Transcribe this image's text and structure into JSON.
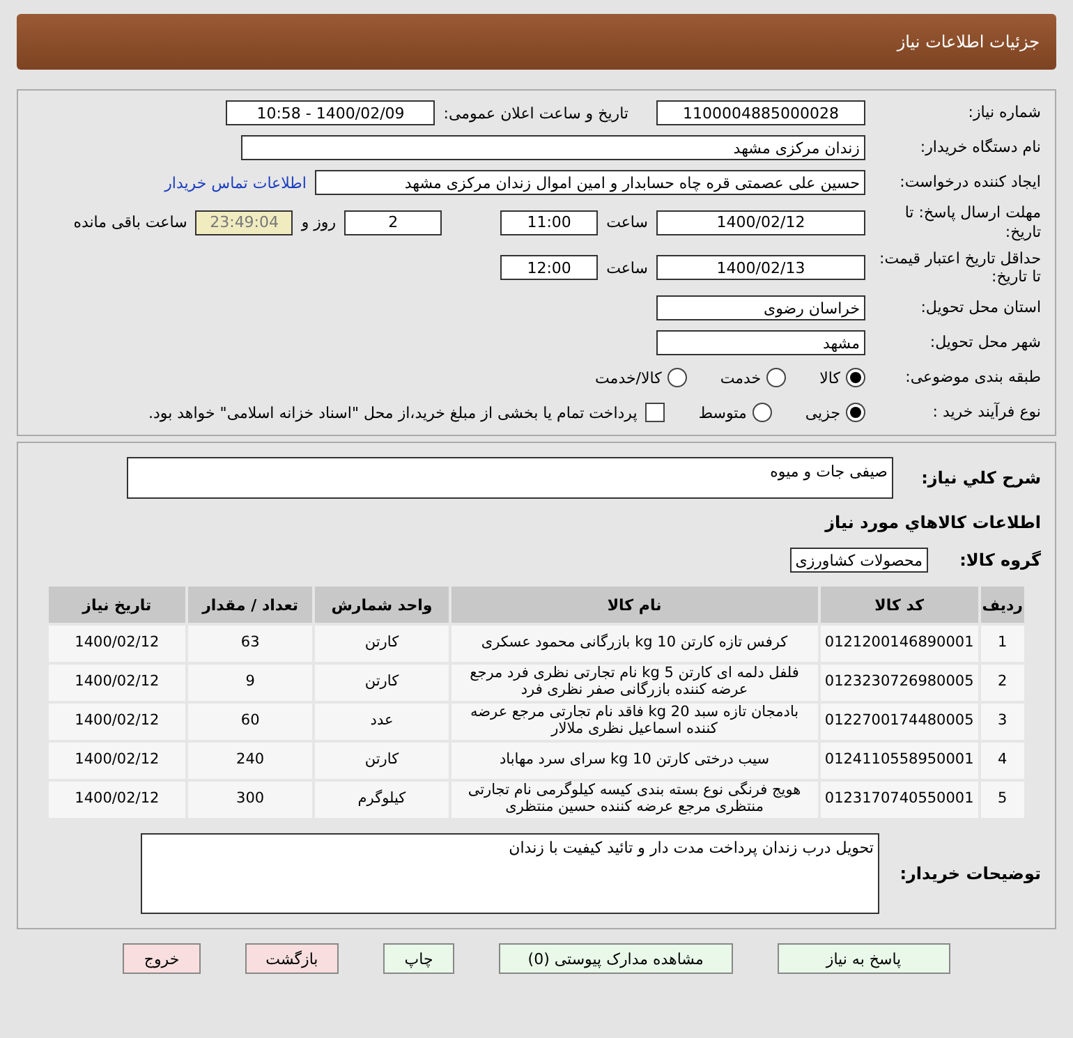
{
  "header": {
    "title": "جزئیات اطلاعات نیاز"
  },
  "need_number": {
    "label": "شماره نیاز:",
    "value": "1100004885000028"
  },
  "announce": {
    "label": "تاریخ و ساعت اعلان عمومی:",
    "value": "1400/02/09 - 10:58"
  },
  "buyer": {
    "label": "نام دستگاه خریدار:",
    "value": "زندان مرکزی مشهد"
  },
  "creator": {
    "label": "ایجاد کننده درخواست:",
    "value": "حسین علی عصمتی قره چاه حسابدار و امین اموال زندان مرکزی مشهد",
    "link": "اطلاعات تماس خریدار"
  },
  "deadline": {
    "label": "مهلت ارسال پاسخ: تا تاریخ:",
    "date": "1400/02/12",
    "time_label": "ساعت",
    "time": "11:00",
    "days": "2",
    "days_label": "روز و",
    "remaining": "23:49:04",
    "remaining_label": "ساعت باقی مانده"
  },
  "validity": {
    "label": "حداقل تاریخ اعتبار قیمت: تا تاریخ:",
    "date": "1400/02/13",
    "time_label": "ساعت",
    "time": "12:00"
  },
  "province": {
    "label": "استان محل تحویل:",
    "value": "خراسان رضوی"
  },
  "city": {
    "label": "شهر محل تحویل:",
    "value": "مشهد"
  },
  "category": {
    "label": "طبقه بندی موضوعی:",
    "options": [
      {
        "label": "کالا",
        "selected": true
      },
      {
        "label": "خدمت",
        "selected": false
      },
      {
        "label": "کالا/خدمت",
        "selected": false
      }
    ]
  },
  "process": {
    "label": "نوع فرآیند خرید :",
    "options": [
      {
        "label": "جزیی",
        "selected": true
      },
      {
        "label": "متوسط",
        "selected": false
      }
    ],
    "treasury": {
      "label": "پرداخت تمام یا بخشی از مبلغ خرید،از محل \"اسناد خزانه اسلامی\" خواهد بود.",
      "checked": false
    }
  },
  "description": {
    "label": "شرح کلي نياز:",
    "value": "صیفی جات و میوه"
  },
  "goods_heading": "اطلاعات کالاهاي مورد نياز",
  "goods_group": {
    "label": "گروه کالا:",
    "value": "محصولات کشاورزی"
  },
  "table": {
    "columns": [
      "ردیف",
      "کد کالا",
      "نام کالا",
      "واحد شمارش",
      "تعداد / مقدار",
      "تاریخ نیاز"
    ],
    "rows": [
      [
        "1",
        "0121200146890001",
        "کرفس تازه کارتن 10 kg بازرگانی محمود عسکری",
        "کارتن",
        "63",
        "1400/02/12"
      ],
      [
        "2",
        "0123230726980005",
        "فلفل دلمه ای کارتن 5 kg نام تجارتی نظری فرد مرجع عرضه کننده بازرگانی صفر نظری فرد",
        "کارتن",
        "9",
        "1400/02/12"
      ],
      [
        "3",
        "0122700174480005",
        "بادمجان تازه سبد 20 kg فاقد نام تجارتی مرجع عرضه کننده اسماعیل نظری ملالار",
        "عدد",
        "60",
        "1400/02/12"
      ],
      [
        "4",
        "0124110558950001",
        "سیب درختی کارتن 10 kg سرای سرد مهاباد",
        "کارتن",
        "240",
        "1400/02/12"
      ],
      [
        "5",
        "0123170740550001",
        "هویج فرنگی نوع بسته بندی کیسه کیلوگرمی نام تجارتی منتظری مرجع عرضه کننده حسین منتظری",
        "کیلوگرم",
        "300",
        "1400/02/12"
      ]
    ]
  },
  "notes": {
    "label": "توضیحات خریدار:",
    "value": "تحویل درب زندان پرداخت مدت دار و تائید کیفیت با زندان"
  },
  "buttons": [
    {
      "label": "پاسخ به نیاز",
      "kind": "normal"
    },
    {
      "label": "مشاهده مدارک پیوستی (0)",
      "kind": "normal"
    },
    {
      "label": "چاپ",
      "kind": "normal"
    },
    {
      "label": "بازگشت",
      "kind": "danger"
    },
    {
      "label": "خروج",
      "kind": "danger"
    }
  ]
}
